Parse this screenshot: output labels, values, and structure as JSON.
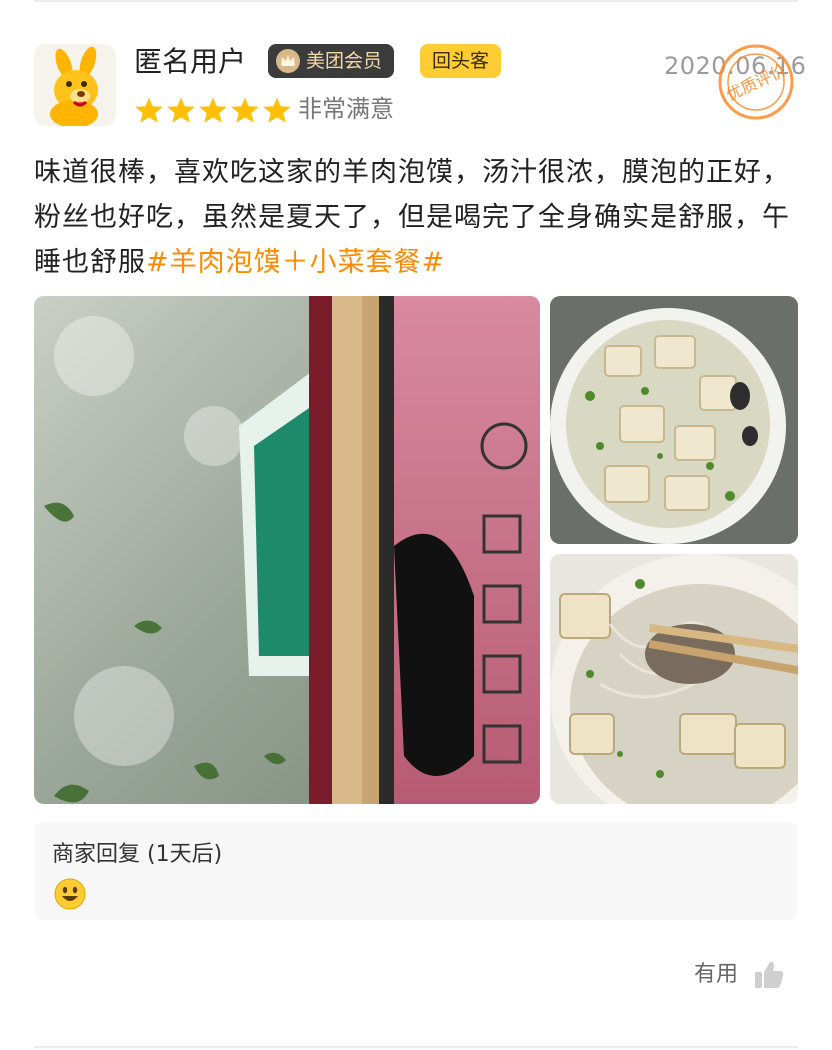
{
  "review": {
    "username": "匿名用户",
    "badges": {
      "member": "美团会员",
      "returning": "回头客"
    },
    "date": "2020.06.16",
    "stamp_text": "优质评价",
    "rating": 5,
    "rating_text": "非常满意",
    "text": "味道很棒，喜欢吃这家的羊肉泡馍，汤汁很浓，膜泡的正好，粉丝也好吃，虽然是夏天了，但是喝完了全身确实是舒服，午睡也舒服",
    "tag": "#羊肉泡馍＋小菜套餐#",
    "photos": [
      {
        "name": "photo-packaging"
      },
      {
        "name": "photo-soup-bowl"
      },
      {
        "name": "photo-soup-chopsticks"
      }
    ]
  },
  "merchant_reply": {
    "label": "商家回复 (1天后)",
    "content_icon": "smiley-icon"
  },
  "actions": {
    "helpful_label": "有用",
    "helpful_icon": "thumbs-up-icon"
  },
  "colors": {
    "accent_orange": "#ff8a00",
    "star_yellow": "#ffc000",
    "return_badge": "#ffcc33",
    "vip_badge": "#3b3b3b"
  }
}
